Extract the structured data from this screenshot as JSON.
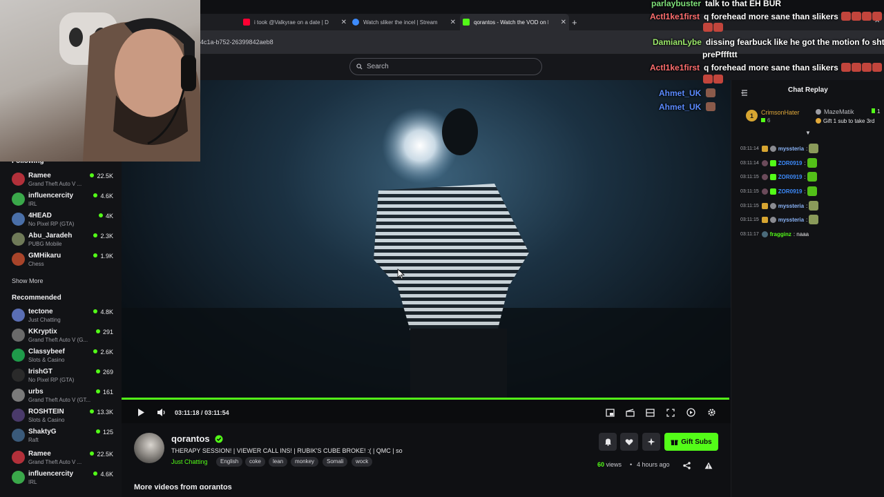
{
  "browser": {
    "tabs": [
      {
        "label": "i took @Valkyrae on a date | Du",
        "favicon_color": "#ff0033",
        "active": false
      },
      {
        "label": "Watch sliker the incel | Stream",
        "favicon_color": "#3d8bfd",
        "active": false
      },
      {
        "label": "qorantos - Watch the VOD on K",
        "favicon_color": "#53fc18",
        "active": true
      }
    ],
    "new_tab_symbol": "+",
    "close_symbol": "✕",
    "url_fragment": "4c1a-b752-26399842aeb8"
  },
  "header": {
    "search_placeholder": "Search"
  },
  "sidebar": {
    "following_label": "Following",
    "following": [
      {
        "name": "Ramee",
        "category": "Grand Theft Auto V ...",
        "viewers": "22.5K",
        "avatar_color": "#b2303a"
      },
      {
        "name": "influencercity",
        "category": "IRL",
        "viewers": "4.6K",
        "avatar_color": "#3aa84a"
      },
      {
        "name": "4HEAD",
        "category": "No Pixel RP (GTA)",
        "viewers": "4K",
        "avatar_color": "#4a6fa8"
      },
      {
        "name": "Abu_Jaradeh",
        "category": "PUBG Mobile",
        "viewers": "2.3K",
        "avatar_color": "#6f7a58"
      },
      {
        "name": "GMHikaru",
        "category": "Chess",
        "viewers": "1.9K",
        "avatar_color": "#a8442a"
      }
    ],
    "show_more_label": "Show More",
    "recommended_label": "Recommended",
    "recommended": [
      {
        "name": "tectone",
        "category": "Just Chatting",
        "viewers": "4.8K",
        "avatar_color": "#5a6eb4"
      },
      {
        "name": "KKryptix",
        "category": "Grand Theft Auto V (G...",
        "viewers": "291",
        "avatar_color": "#6a6a6a"
      },
      {
        "name": "Classybeef",
        "category": "Slots & Casino",
        "viewers": "2.6K",
        "avatar_color": "#1f9a4a"
      },
      {
        "name": "IrishGT",
        "category": "No Pixel RP (GTA)",
        "viewers": "269",
        "avatar_color": "#2a2a2a"
      },
      {
        "name": "urbs",
        "category": "Grand Theft Auto V (GT...",
        "viewers": "161",
        "avatar_color": "#7a7a7a"
      },
      {
        "name": "ROSHTEIN",
        "category": "Slots & Casino",
        "viewers": "13.3K",
        "avatar_color": "#4a3a6a"
      },
      {
        "name": "ShaktyG",
        "category": "Raft",
        "viewers": "125",
        "avatar_color": "#3a5a7a"
      },
      {
        "name": "Ramee",
        "category": "Grand Theft Auto V ...",
        "viewers": "22.5K",
        "avatar_color": "#b2303a"
      },
      {
        "name": "influencercity",
        "category": "IRL",
        "viewers": "4.6K",
        "avatar_color": "#3aa84a"
      }
    ]
  },
  "player": {
    "current_time": "03:11:18",
    "separator": "/",
    "duration": "03:11:54",
    "progress_fraction": 0.998
  },
  "stream": {
    "channel": "qorantos",
    "title": "THERAPY SESSION! | VIEWER CALL INS! | RUBIK'S CUBE BROKE! :( | QMC | so",
    "category": "Just Chatting",
    "tags": [
      "English",
      "coke",
      "lean",
      "monkey",
      "Somali",
      "wock"
    ],
    "views_count": "60",
    "views_label": "views",
    "time_ago": "4 hours ago",
    "gift_subs_label": "Gift Subs",
    "more_videos_label": "More videos from qorantos"
  },
  "chat": {
    "title": "Chat Replay",
    "top_gifter": {
      "rank": "1",
      "name": "CrimsonHater",
      "count": "6"
    },
    "pinned": {
      "name": "MazeMatik",
      "count": "1",
      "message": "Gift 1 sub to take 3rd"
    },
    "messages": [
      {
        "time": "03:11:14",
        "user": "myssteria",
        "user_color": "#8ab4f8",
        "text": ":",
        "emote_color": "#8a9a5a"
      },
      {
        "time": "03:11:14",
        "user": "ZOR0919",
        "user_color": "#3d8bfd",
        "text": ":",
        "emote_color": "#53c018"
      },
      {
        "time": "03:11:15",
        "user": "ZOR0919",
        "user_color": "#3d8bfd",
        "text": ":",
        "emote_color": "#53c018"
      },
      {
        "time": "03:11:15",
        "user": "ZOR0919",
        "user_color": "#3d8bfd",
        "text": ":",
        "emote_color": "#53c018"
      },
      {
        "time": "03:11:15",
        "user": "myssteria",
        "user_color": "#8ab4f8",
        "text": ":",
        "emote_color": "#8a9a5a"
      },
      {
        "time": "03:11:15",
        "user": "myssteria",
        "user_color": "#8ab4f8",
        "text": ":",
        "emote_color": "#8a9a5a"
      },
      {
        "time": "03:11:17",
        "user": "fragginz",
        "user_color": "#53fc18",
        "text": ": naaa",
        "emote_color": ""
      }
    ]
  },
  "overlay_chat": [
    {
      "user": "parlaybuster",
      "color": "#7fe17a",
      "text": "talk to that EH BUR",
      "emotes": 0
    },
    {
      "user": "Actl1ke1first",
      "color": "#ff6e6e",
      "text": "q forehead more sane than slikers",
      "emotes": 4
    },
    {
      "user": "DamianLybe",
      "color": "#9be86a",
      "text": "dissing fearbuck like he got the motion fo sht",
      "emotes": 0
    },
    {
      "user": "",
      "color": "#ffffff",
      "text": "prePfffttt",
      "emotes": 0
    },
    {
      "user": "Actl1ke1first",
      "color": "#ff6e6e",
      "text": "q forehead more sane than slikers",
      "emotes": 4
    },
    {
      "user": "Ahmet_UK",
      "color": "#5b8bff",
      "text": "",
      "emotes": 1
    },
    {
      "user": "Ahmet_UK",
      "color": "#5b8bff",
      "text": "",
      "emotes": 1
    }
  ]
}
